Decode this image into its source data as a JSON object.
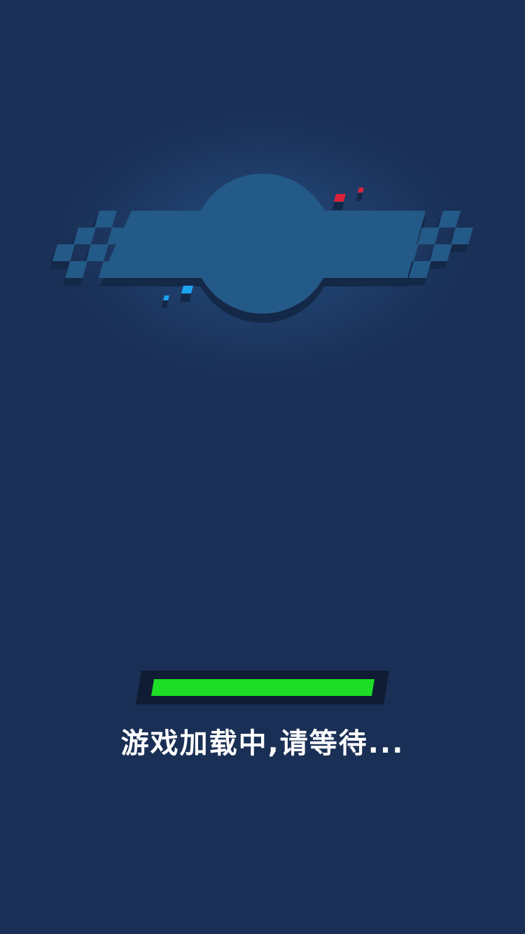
{
  "loading_screen": {
    "message": "游戏加载中,请等待...",
    "progress": 1.0,
    "colors": {
      "background": "#1a2f55",
      "emblem": "#245a87",
      "emblem_shadow": "#142848",
      "progress_track": "#101c33",
      "progress_fill": "#1ddd27",
      "text": "#ffffff",
      "accent_red": "#d8223a",
      "accent_blue": "#1ba3f0"
    },
    "icons": {
      "logo": "checkered-flag-racing-emblem-icon"
    }
  }
}
